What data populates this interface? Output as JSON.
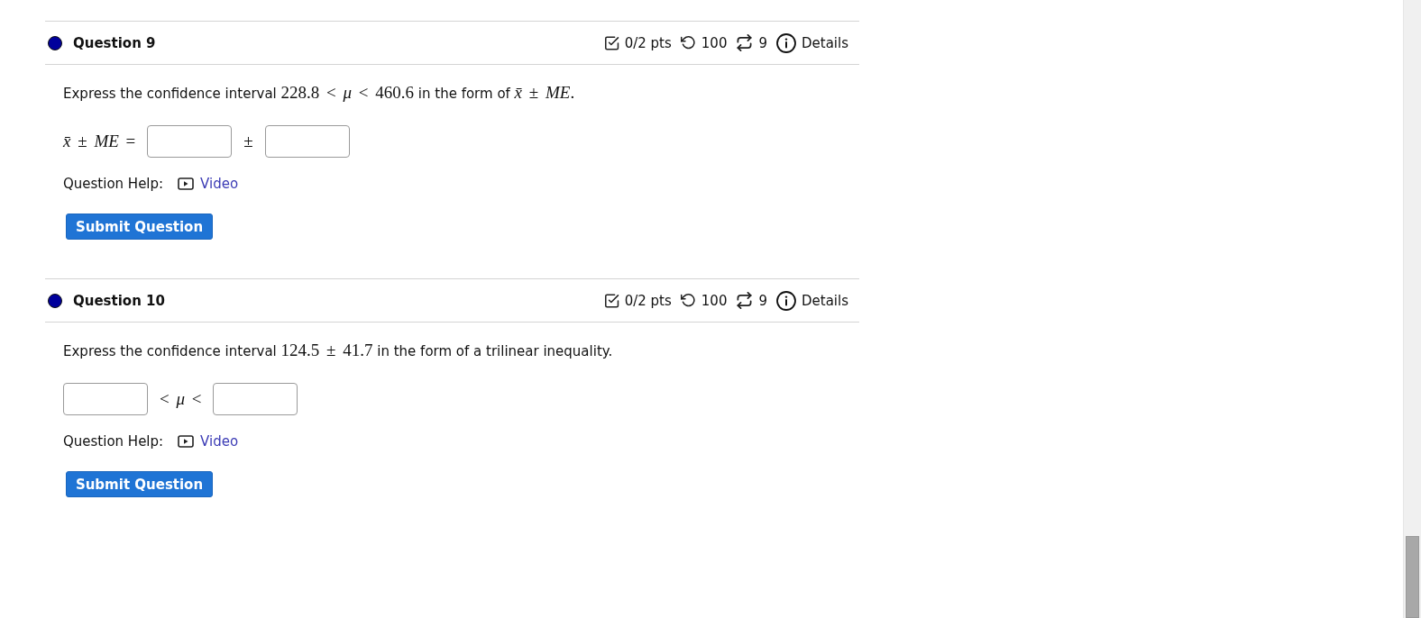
{
  "questions": [
    {
      "title": "Question 9",
      "color": "#00009c",
      "meta": {
        "score": "0/2 pts",
        "attempts": "100",
        "retries": "9",
        "details": "Details"
      },
      "prompt": [
        {
          "kind": "text",
          "text": "Express the confidence interval "
        },
        {
          "kind": "math",
          "text": "228.8 < *μ* < 460.6"
        },
        {
          "kind": "text",
          "text": " in the form of "
        },
        {
          "kind": "math",
          "text": "*x̄* ± *ME*."
        }
      ],
      "answer": [
        {
          "kind": "math",
          "text": "*x̄* ± *ME* ="
        },
        {
          "kind": "input"
        },
        {
          "kind": "math",
          "text": "±"
        },
        {
          "kind": "input"
        }
      ],
      "help": {
        "label": "Question Help:",
        "link": "Video"
      },
      "submit": "Submit Question"
    },
    {
      "title": "Question 10",
      "color": "#00009c",
      "meta": {
        "score": "0/2 pts",
        "attempts": "100",
        "retries": "9",
        "details": "Details"
      },
      "prompt": [
        {
          "kind": "text",
          "text": "Express the confidence interval "
        },
        {
          "kind": "math",
          "text": "124.5 ± 41.7"
        },
        {
          "kind": "text",
          "text": " in the form of a trilinear inequality."
        }
      ],
      "answer": [
        {
          "kind": "input"
        },
        {
          "kind": "math",
          "text": "< *μ* <"
        },
        {
          "kind": "input"
        }
      ],
      "help": {
        "label": "Question Help:",
        "link": "Video"
      },
      "submit": "Submit Question"
    }
  ]
}
